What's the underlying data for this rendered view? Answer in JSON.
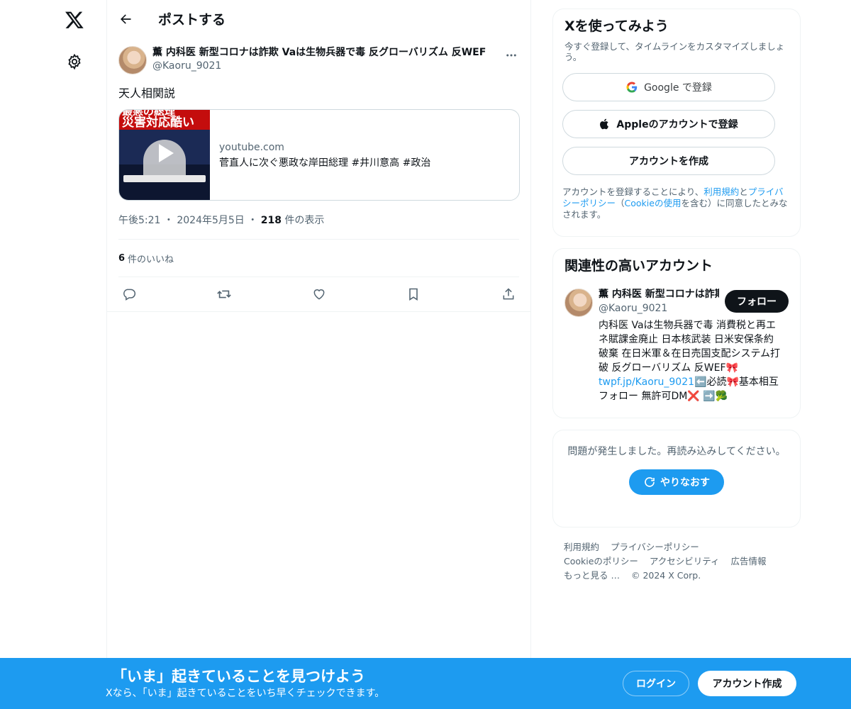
{
  "header": {
    "title": "ポストする"
  },
  "post": {
    "author_name": "薫 内科医 新型コロナは詐欺 Vaは生物兵器で毒 反グローバリズム 反WEF",
    "author_handle": "@Kaoru_9021",
    "text": "天人相関説",
    "card": {
      "thumb_line1": "最悪の総理",
      "thumb_line2": "災害対応酷い",
      "domain": "youtube.com",
      "title": "菅直人に次ぐ悪政な岸田総理 #井川意高 #政治"
    },
    "time": "午後5:21",
    "dot1": "・",
    "date": "2024年5月5日",
    "dot2": "・",
    "views_count": "218",
    "views_label": "件の表示",
    "likes_count": "6",
    "likes_label": "件のいいね"
  },
  "signup": {
    "title": "Xを使ってみよう",
    "subtitle": "今すぐ登録して、タイムラインをカスタマイズしましょう。",
    "google_label": "Google で登録",
    "apple_label": "Appleのアカウントで登録",
    "create_label": "アカウントを作成",
    "legal_prefix": "アカウントを登録することにより、",
    "legal_terms": "利用規約",
    "legal_and": "と",
    "legal_privacy": "プライバシーポリシー",
    "legal_open": "（",
    "legal_cookie": "Cookieの使用",
    "legal_suffix": "を含む）に同意したとみなされます。"
  },
  "related": {
    "title": "関連性の高いアカウント",
    "name": "薫 内科医 新型コロナは詐欺 Vaは生物兵器で毒",
    "handle": "@Kaoru_9021",
    "follow_label": "フォロー",
    "bio_part1": "内科医 Vaは生物兵器で毒 消費税と再エネ賦課金廃止 日本核武装 日米安保条約破棄 在日米軍＆在日売国支配システム打破 反グローバリズム 反WEF🎀",
    "bio_link": "twpf.jp/Kaoru_9021",
    "bio_part2": "⬅️必読🎀基本相互フォロー 無許可DM❌ ➡️🥦"
  },
  "error": {
    "message": "問題が発生しました。再読み込みしてください。",
    "retry_label": "やりなおす"
  },
  "footer": {
    "terms": "利用規約",
    "privacy": "プライバシーポリシー",
    "cookie": "Cookieのポリシー",
    "accessibility": "アクセシビリティ",
    "ads": "広告情報",
    "more": "もっと見る …",
    "copyright": "© 2024 X Corp."
  },
  "banner": {
    "title": "「いま」起きていることを見つけよう",
    "subtitle": "Xなら、「いま」起きていることをいち早くチェックできます。",
    "login_label": "ログイン",
    "signup_label": "アカウント作成"
  },
  "colors": {
    "accent": "#1d9bf0",
    "text": "#0f1419",
    "muted": "#536471",
    "border": "#eff3f4"
  }
}
